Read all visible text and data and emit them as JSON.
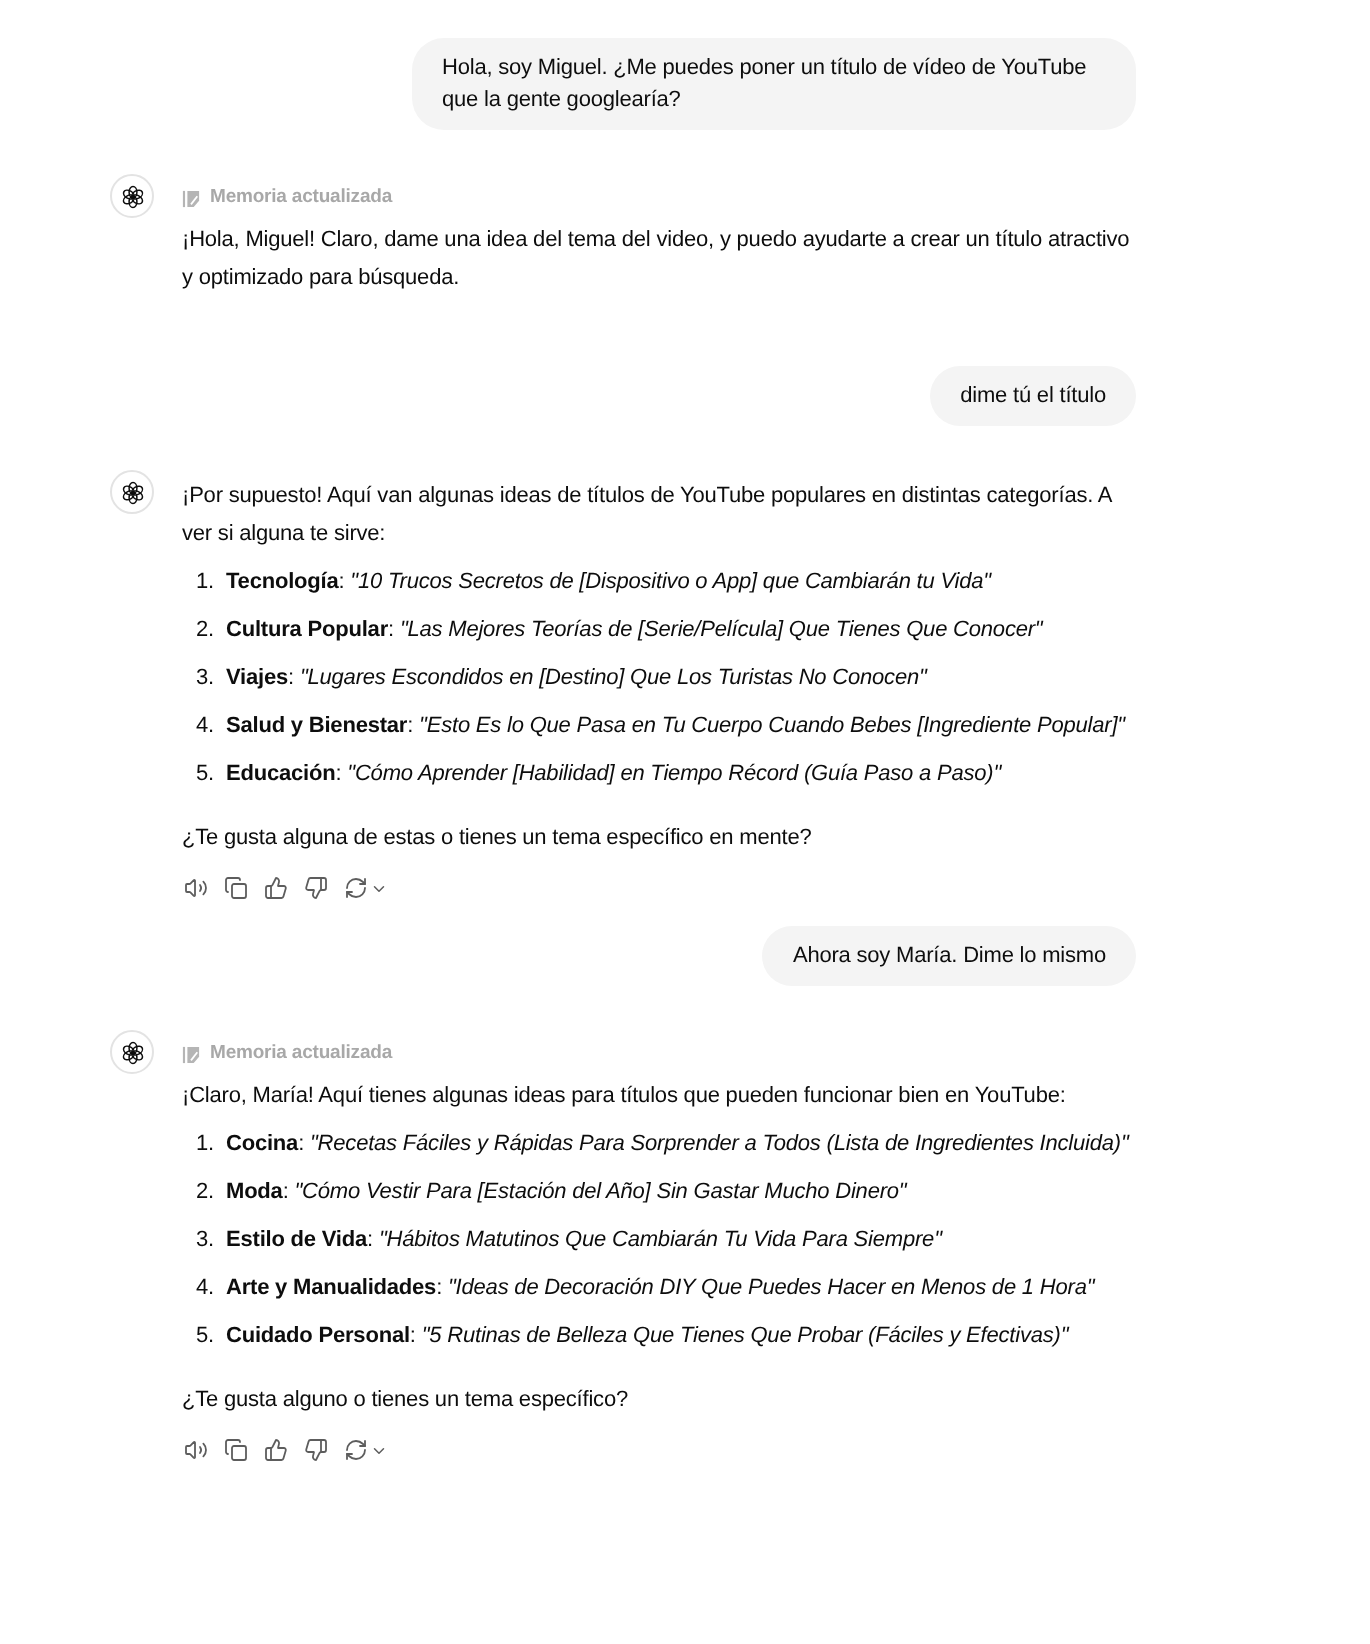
{
  "messages": [
    {
      "kind": "user",
      "text": "Hola, soy Miguel. ¿Me puedes poner un título de vídeo de YouTube que la gente googlearía?"
    },
    {
      "kind": "assistant",
      "memory_note": "Memoria actualizada",
      "action_bar": false,
      "blocks": [
        {
          "kind": "paragraph",
          "text": "¡Hola, Miguel! Claro, dame una idea del tema del video, y puedo ayudarte a crear un título atractivo y optimizado para búsqueda."
        }
      ]
    },
    {
      "kind": "user",
      "text": "dime tú el título"
    },
    {
      "kind": "assistant",
      "action_bar": true,
      "blocks": [
        {
          "kind": "paragraph",
          "text": "¡Por supuesto! Aquí van algunas ideas de títulos de YouTube populares en distintas categorías. A ver si alguna te sirve:"
        },
        {
          "kind": "list",
          "items": [
            {
              "number": "1.",
              "text": "**Tecnología**: *\"10 Trucos Secretos de [Dispositivo o App] que Cambiarán tu Vida\"*"
            },
            {
              "number": "2.",
              "text": "**Cultura Popular**: *\"Las Mejores Teorías de [Serie/Película] Que Tienes Que Conocer\"*"
            },
            {
              "number": "3.",
              "text": "**Viajes**: *\"Lugares Escondidos en [Destino] Que Los Turistas No Conocen\"*"
            },
            {
              "number": "4.",
              "text": "**Salud y Bienestar**: *\"Esto Es lo Que Pasa en Tu Cuerpo Cuando Bebes [Ingrediente Popular]\"*"
            },
            {
              "number": "5.",
              "text": "**Educación**: *\"Cómo Aprender [Habilidad] en Tiempo Récord (Guía Paso a Paso)\"*"
            }
          ]
        },
        {
          "kind": "paragraph",
          "text": "¿Te gusta alguna de estas o tienes un tema específico en mente?"
        }
      ]
    },
    {
      "kind": "user",
      "text": "Ahora soy María. Dime lo mismo"
    },
    {
      "kind": "assistant",
      "memory_note": "Memoria actualizada",
      "action_bar": true,
      "blocks": [
        {
          "kind": "paragraph",
          "text": "¡Claro, María! Aquí tienes algunas ideas para títulos que pueden funcionar bien en YouTube:"
        },
        {
          "kind": "list",
          "items": [
            {
              "number": "1.",
              "text": "**Cocina**: *\"Recetas Fáciles y Rápidas Para Sorprender a Todos (Lista de Ingredientes Incluida)\"*"
            },
            {
              "number": "2.",
              "text": "**Moda**: *\"Cómo Vestir Para [Estación del Año] Sin Gastar Mucho Dinero\"*"
            },
            {
              "number": "3.",
              "text": "**Estilo de Vida**: *\"Hábitos Matutinos Que Cambiarán Tu Vida Para Siempre\"*"
            },
            {
              "number": "4.",
              "text": "**Arte y Manualidades**: *\"Ideas de Decoración DIY Que Puedes Hacer en Menos de 1 Hora\"*"
            },
            {
              "number": "5.",
              "text": "**Cuidado Personal**: *\"5 Rutinas de Belleza Que Tienes Que Probar (Fáciles y Efectivas)\"*"
            }
          ]
        },
        {
          "kind": "paragraph",
          "text": "¿Te gusta alguno o tienes un tema específico?"
        }
      ]
    }
  ]
}
